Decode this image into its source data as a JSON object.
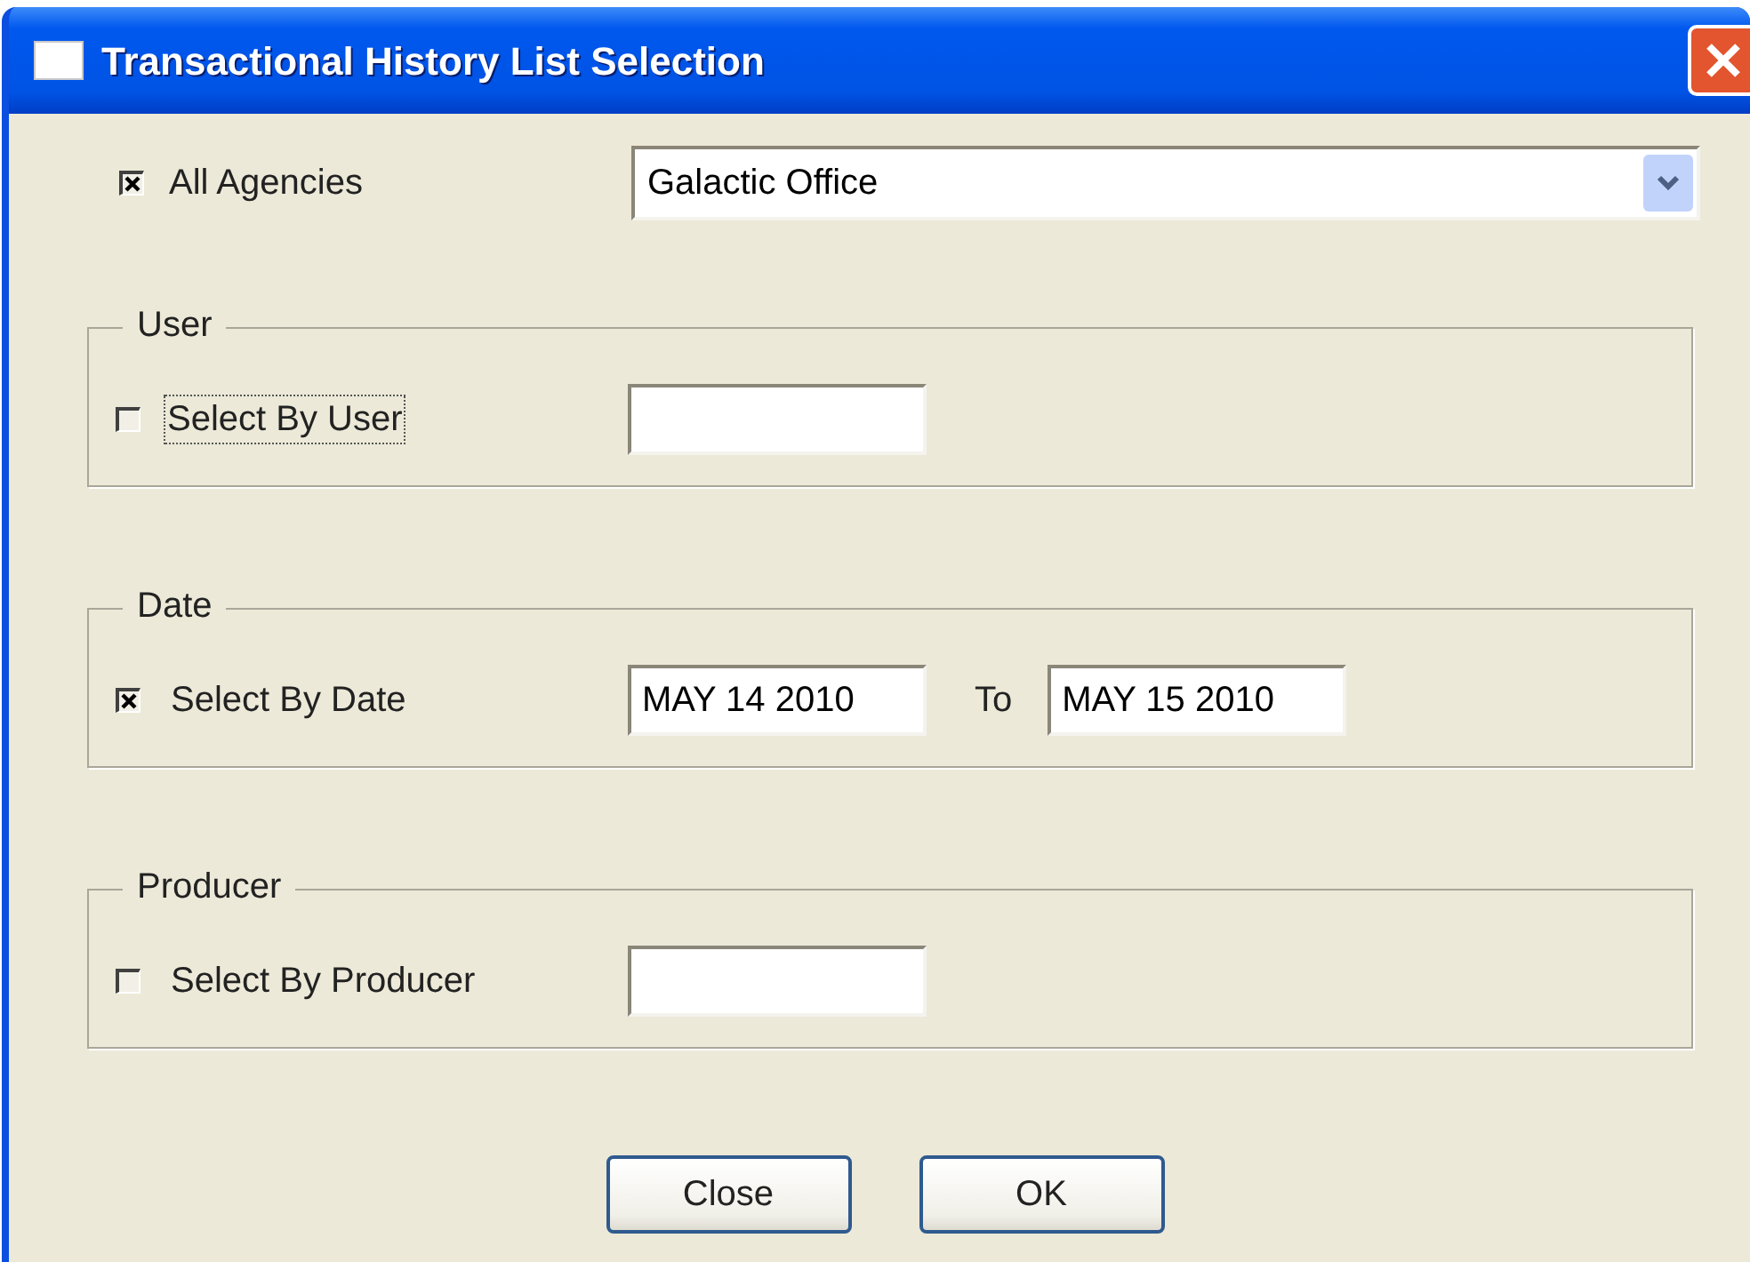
{
  "window": {
    "title": "Transactional History List Selection"
  },
  "agency": {
    "label": "All Agencies",
    "checked": true,
    "value": "Galactic Office"
  },
  "groups": [
    {
      "title": "User",
      "label": "Select By User",
      "checked": false,
      "focused": true,
      "kind": "single"
    },
    {
      "title": "Date",
      "label": "Select By Date",
      "checked": true,
      "focused": false,
      "kind": "range",
      "from": "MAY 14 2010",
      "to_label": "To",
      "to": "MAY 15 2010"
    },
    {
      "title": "Producer",
      "label": "Select By Producer",
      "checked": false,
      "focused": false,
      "kind": "single"
    }
  ],
  "buttons": [
    "Close",
    "OK"
  ]
}
